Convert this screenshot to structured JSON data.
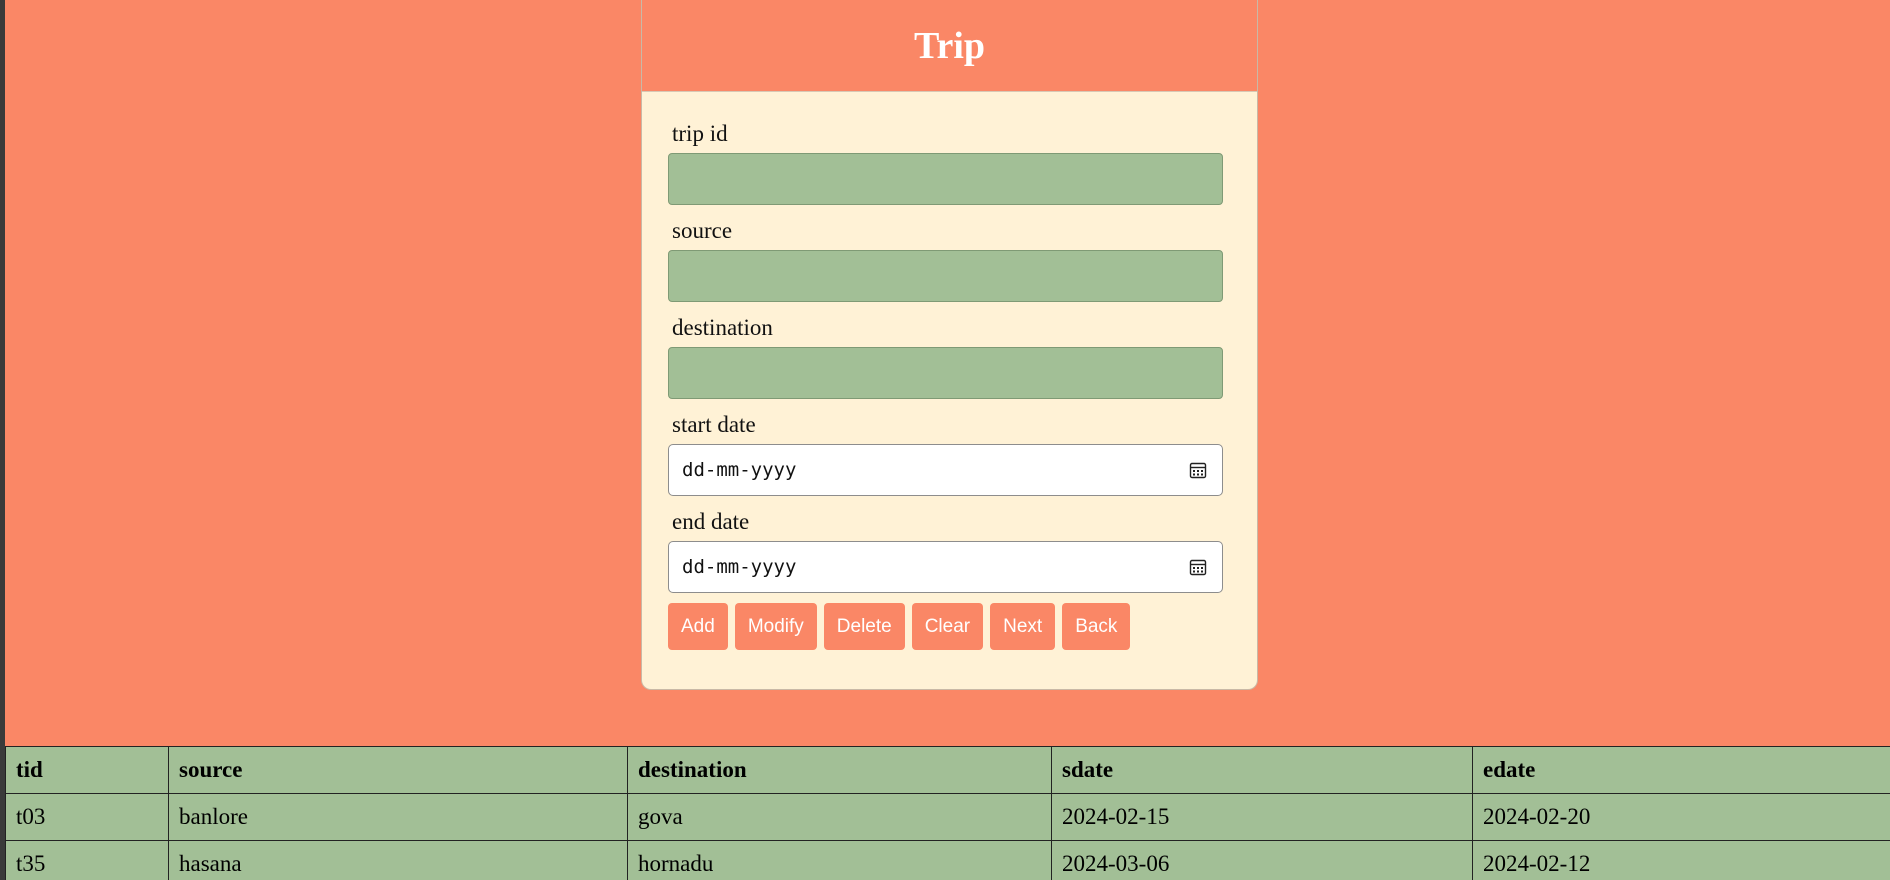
{
  "form": {
    "title": "Trip",
    "fields": {
      "trip_id": {
        "label": "trip id",
        "value": ""
      },
      "source": {
        "label": "source",
        "value": ""
      },
      "destination": {
        "label": "destination",
        "value": ""
      },
      "start_date": {
        "label": "start date",
        "placeholder": "dd-mm-yyyy"
      },
      "end_date": {
        "label": "end date",
        "placeholder": "dd-mm-yyyy"
      }
    },
    "buttons": {
      "add": "Add",
      "modify": "Modify",
      "delete": "Delete",
      "clear": "Clear",
      "next": "Next",
      "back": "Back"
    }
  },
  "table": {
    "headers": [
      "tid",
      "source",
      "destination",
      "sdate",
      "edate"
    ],
    "rows": [
      [
        "t03",
        "banlore",
        "gova",
        "2024-02-15",
        "2024-02-20"
      ],
      [
        "t35",
        "hasana",
        "hornadu",
        "2024-03-06",
        "2024-02-12"
      ]
    ]
  },
  "colors": {
    "background": "#fa8766",
    "card": "#fff2d6",
    "input": "#a2bf96",
    "table": "#a2bf96"
  },
  "icons": {
    "date_picker": "calendar-icon"
  }
}
